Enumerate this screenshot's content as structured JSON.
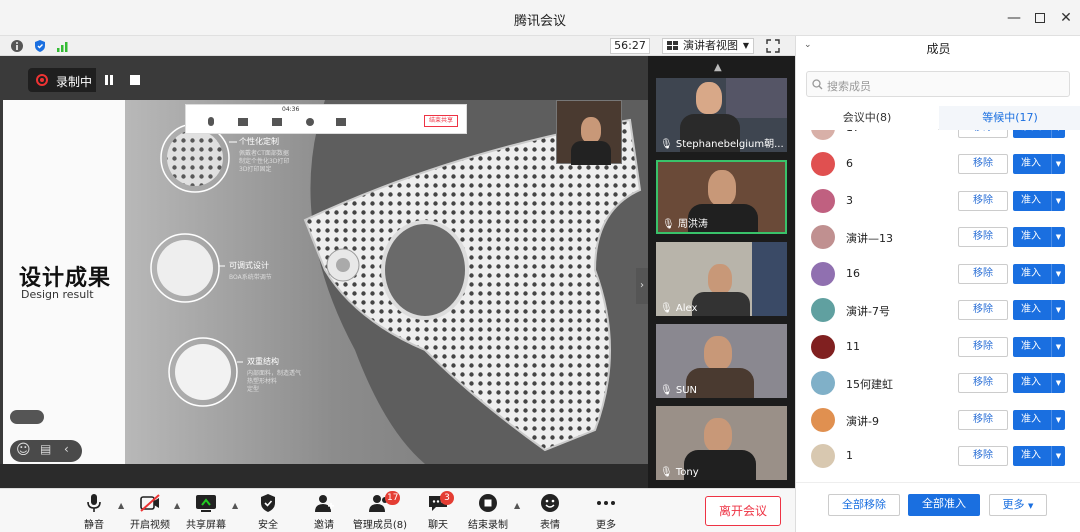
{
  "window": {
    "title": "腾讯会议"
  },
  "info_bar": {
    "timer": "56:27",
    "view_label": "演讲者视图"
  },
  "recording": {
    "label": "录制中"
  },
  "slide": {
    "title": "设计成果",
    "subtitle": "Design result",
    "mini_toolbar": {
      "timer": "04:36",
      "leave": "结束共享"
    },
    "features": [
      {
        "label": "个性化定制",
        "desc": [
          "佩戴者CT面部数据",
          "制定个性化3D打印",
          "3D打印固定"
        ]
      },
      {
        "label": "可调式设计",
        "desc": [
          "BOA系统带调节"
        ]
      },
      {
        "label": "双重结构",
        "desc": [
          "内部面料，制造透气",
          "热塑形材料",
          "定型"
        ]
      }
    ]
  },
  "videos": [
    {
      "name": "Stephanebelgium朝..."
    },
    {
      "name": "周洪涛"
    },
    {
      "name": "Alex"
    },
    {
      "name": "SUN"
    },
    {
      "name": "Tony"
    }
  ],
  "toolbar": {
    "items": [
      {
        "label": "静音",
        "icon": "mic-icon"
      },
      {
        "label": "开启视频",
        "icon": "camera-off-icon"
      },
      {
        "label": "共享屏幕",
        "icon": "share-screen-icon"
      },
      {
        "label": "安全",
        "icon": "shield-icon"
      },
      {
        "label": "邀请",
        "icon": "invite-icon"
      },
      {
        "label": "管理成员(8)",
        "icon": "members-icon",
        "badge": "17"
      },
      {
        "label": "聊天",
        "icon": "chat-icon",
        "badge": "3"
      },
      {
        "label": "结束录制",
        "icon": "stop-record-icon"
      },
      {
        "label": "表情",
        "icon": "emoji-icon"
      },
      {
        "label": "更多",
        "icon": "more-icon"
      }
    ],
    "leave_label": "离开会议"
  },
  "panel": {
    "title": "成员",
    "search_placeholder": "搜索成员",
    "tab_in_meeting": "会议中(8)",
    "tab_waiting": "等候中(17)",
    "remove_label": "移除",
    "admit_label": "准入",
    "members": [
      {
        "name": "17",
        "color": "#d8b0a8"
      },
      {
        "name": "6",
        "color": "#e05050"
      },
      {
        "name": "3",
        "color": "#c06080"
      },
      {
        "name": "演讲—13",
        "color": "#c09090"
      },
      {
        "name": "16",
        "color": "#9070b0"
      },
      {
        "name": "演讲-7号",
        "color": "#60a0a0"
      },
      {
        "name": "11",
        "color": "#802020"
      },
      {
        "name": "15何建虹",
        "color": "#80b0c8"
      },
      {
        "name": "演讲-9",
        "color": "#e09050"
      },
      {
        "name": "1",
        "color": "#d8c8b0"
      }
    ],
    "remove_all": "全部移除",
    "admit_all": "全部准入",
    "more": "更多"
  },
  "colors": {
    "accent": "#1a6fe0",
    "danger": "#e34",
    "active_border": "#39c26a"
  }
}
